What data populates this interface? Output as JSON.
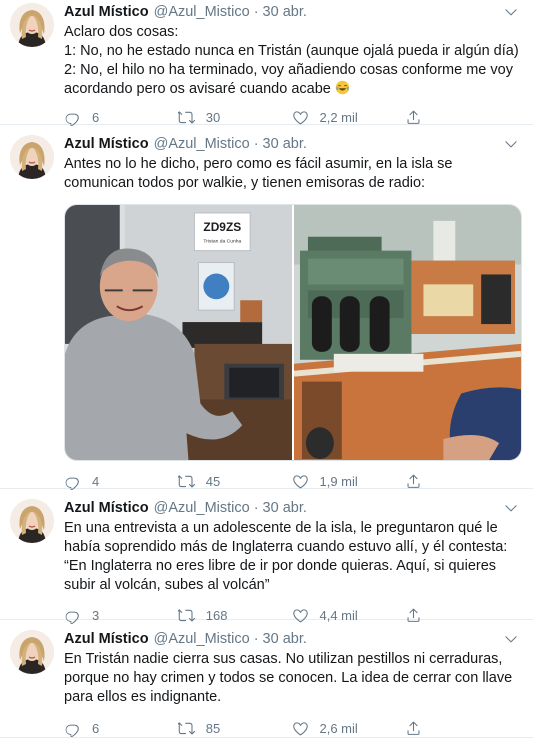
{
  "colors": {
    "text": "#14171a",
    "secondary": "#657786",
    "divider": "#e6ecf0"
  },
  "icons": {
    "reply": "reply-icon",
    "retweet": "retweet-icon",
    "like": "heart-icon",
    "share": "share-icon",
    "menu": "chevron-down-icon"
  },
  "tweets": [
    {
      "name": "Azul Místico",
      "handle": "@Azul_Mistico",
      "dot": "·",
      "date": "30 abr.",
      "text": "Aclaro dos cosas:\n1: No, no he estado nunca en Tristán (aunque ojalá pueda ir algún día)\n2: No, el hilo no ha terminado, voy añadiendo cosas conforme me voy acordando pero os avisaré cuando acabe",
      "emoji": "face-with-tears-of-joy",
      "replies": "6",
      "retweets": "30",
      "likes": "2,2 mil"
    },
    {
      "name": "Azul Místico",
      "handle": "@Azul_Mistico",
      "dot": "·",
      "date": "30 abr.",
      "text": "Antes no lo he dicho, pero como es fácil asumir, en la isla se comunican todos por walkie, y tienen emisoras de radio:",
      "media": {
        "sign_callsign": "ZD9ZS",
        "sign_subtitle": "Tristan da Cunha"
      },
      "replies": "4",
      "retweets": "45",
      "likes": "1,9 mil"
    },
    {
      "name": "Azul Místico",
      "handle": "@Azul_Mistico",
      "dot": "·",
      "date": "30 abr.",
      "text": "En una entrevista a un adolescente de la isla, le preguntaron qué le había soprendido más de Inglaterra cuando estuvo allí, y él contesta:\n“En Inglaterra no eres libre de ir por donde quieras. Aquí, si quieres subir al volcán, subes al volcán”",
      "replies": "3",
      "retweets": "168",
      "likes": "4,4 mil"
    },
    {
      "name": "Azul Místico",
      "handle": "@Azul_Mistico",
      "dot": "·",
      "date": "30 abr.",
      "text": "En Tristán nadie cierra sus casas. No utilizan pestillos ni cerraduras, porque no hay crimen y todos se conocen. La idea de cerrar con llave para ellos es indignante.",
      "replies": "6",
      "retweets": "85",
      "likes": "2,6 mil"
    }
  ]
}
